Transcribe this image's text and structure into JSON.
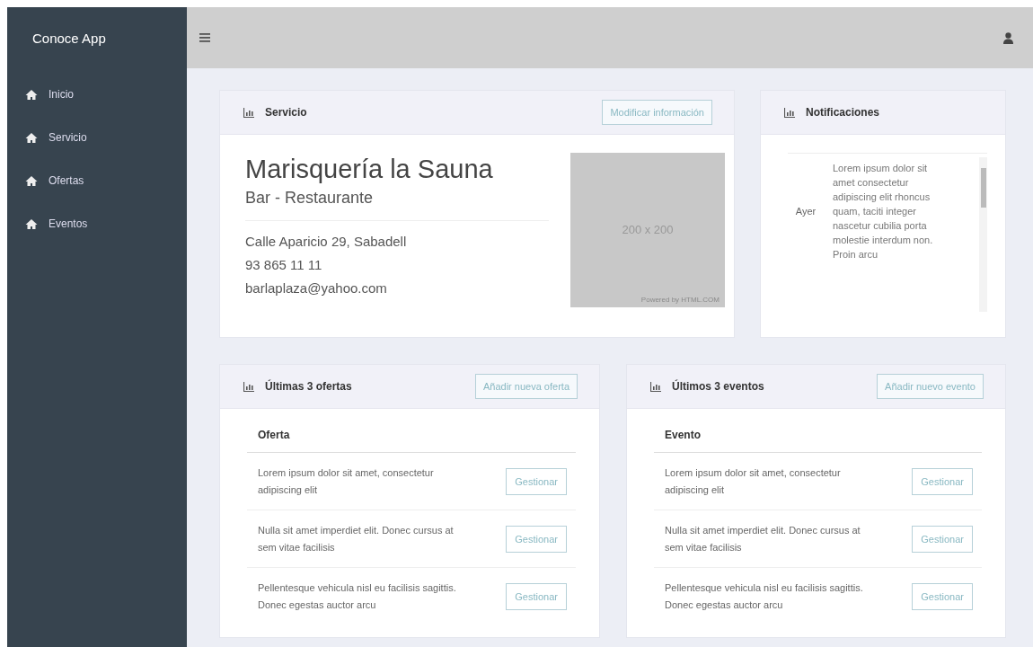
{
  "sidebar": {
    "brand": "Conoce App",
    "items": [
      {
        "label": "Inicio"
      },
      {
        "label": "Servicio"
      },
      {
        "label": "Ofertas"
      },
      {
        "label": "Eventos"
      }
    ]
  },
  "service": {
    "title": "Servicio",
    "button": "Modificar información",
    "name": "Marisquería la Sauna",
    "category": "Bar - Restaurante",
    "address": "Calle Aparicio 29, Sabadell",
    "phone": "93 865 11 11",
    "email": "barlaplaza@yahoo.com",
    "image": {
      "label": "200 x 200",
      "credit": "Powered by HTML.COM"
    }
  },
  "notifications": {
    "title": "Notificaciones",
    "items": [
      {
        "date": "Ayer",
        "text": "Lorem ipsum dolor sit amet consectetur adipiscing elit rhoncus quam, taciti integer nascetur cubilia porta molestie interdum non. Proin arcu"
      }
    ]
  },
  "lists": [
    {
      "title": "Últimas 3 ofertas",
      "button": "Añadir nueva oferta",
      "column": "Oferta",
      "rows": [
        {
          "text": "Lorem ipsum dolor sit amet, consectetur adipiscing elit",
          "action": "Gestionar"
        },
        {
          "text": "Nulla sit amet imperdiet elit. Donec cursus at sem vitae facilisis",
          "action": "Gestionar"
        },
        {
          "text": "Pellentesque vehicula nisl eu facilisis sagittis. Donec egestas auctor arcu",
          "action": "Gestionar"
        }
      ]
    },
    {
      "title": "Últimos 3 eventos",
      "button": "Añadir nuevo evento",
      "column": "Evento",
      "rows": [
        {
          "text": "Lorem ipsum dolor sit amet, consectetur adipiscing elit",
          "action": "Gestionar"
        },
        {
          "text": "Nulla sit amet imperdiet elit. Donec cursus at sem vitae facilisis",
          "action": "Gestionar"
        },
        {
          "text": "Pellentesque vehicula nisl eu facilisis sagittis. Donec egestas auctor arcu",
          "action": "Gestionar"
        }
      ]
    }
  ]
}
